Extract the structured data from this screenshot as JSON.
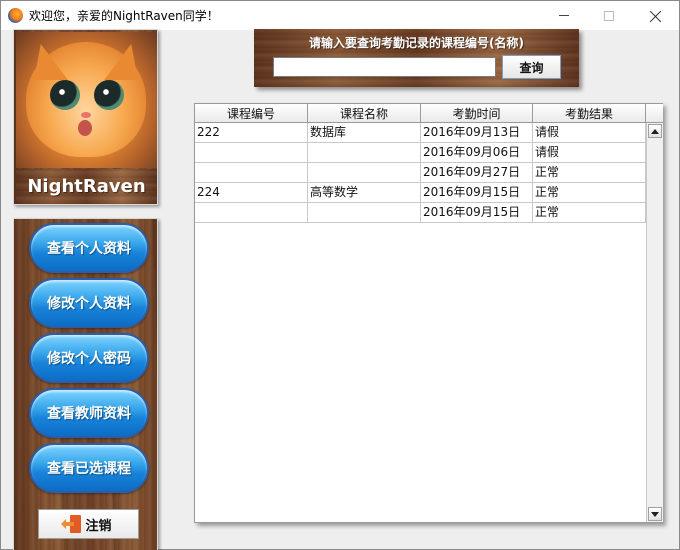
{
  "window": {
    "title": "欢迎您，亲爱的NightRaven同学！",
    "icon": "firefox-icon",
    "controls": [
      "minimize-icon",
      "maximize-icon",
      "close-icon"
    ]
  },
  "profile": {
    "username": "NightRaven",
    "avatar": "cat-avatar"
  },
  "menu": {
    "items": [
      {
        "label": "查看个人资料"
      },
      {
        "label": "修改个人资料"
      },
      {
        "label": "修改个人密码"
      },
      {
        "label": "查看教师资料"
      },
      {
        "label": "查看已选课程"
      }
    ],
    "logout": {
      "label": "注销",
      "icon": "logout-door-icon"
    }
  },
  "search": {
    "title": "请输入要查询考勤记录的课程编号(名称)",
    "value": "",
    "placeholder": "",
    "button_label": "查询"
  },
  "table": {
    "columns": [
      "课程编号",
      "课程名称",
      "考勤时间",
      "考勤结果"
    ],
    "rows": [
      [
        "222",
        "数据库",
        "2016年09月13日",
        "请假"
      ],
      [
        "",
        "",
        "2016年09月06日",
        "请假"
      ],
      [
        "",
        "",
        "2016年09月27日",
        "正常"
      ],
      [
        "224",
        "高等数学",
        "2016年09月15日",
        "正常"
      ],
      [
        "",
        "",
        "2016年09月15日",
        "正常"
      ]
    ]
  },
  "colors": {
    "menu_button": "#1782d8",
    "wood": "#7a4a2b",
    "window_bg": "#eeeeee"
  }
}
